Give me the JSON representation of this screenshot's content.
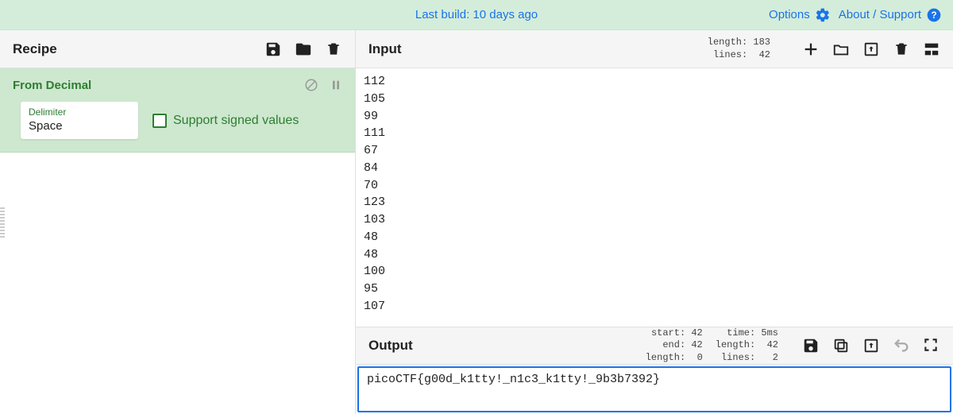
{
  "banner": {
    "build_text": "Last build: 10 days ago",
    "options_label": "Options",
    "about_label": "About / Support"
  },
  "recipe": {
    "title": "Recipe",
    "operation": {
      "name": "From Decimal",
      "delimiter_label": "Delimiter",
      "delimiter_value": "Space",
      "signed_label": "Support signed values",
      "signed_checked": false
    }
  },
  "input": {
    "title": "Input",
    "stats": {
      "length_label": "length:",
      "length_value": "183",
      "lines_label": "lines:",
      "lines_value": "42"
    },
    "content": "112\n105\n99\n111\n67\n84\n70\n123\n103\n48\n48\n100\n95\n107"
  },
  "output": {
    "title": "Output",
    "stats": {
      "start_label": "start:",
      "start_value": "42",
      "end_label": "end:",
      "end_value": "42",
      "sel_length_label": "length:",
      "sel_length_value": "0",
      "time_label": "time:",
      "time_value": "5ms",
      "length_label": "length:",
      "length_value": "42",
      "lines_label": "lines:",
      "lines_value": "2"
    },
    "content": "picoCTF{g00d_k1tty!_n1c3_k1tty!_9b3b7392}"
  }
}
